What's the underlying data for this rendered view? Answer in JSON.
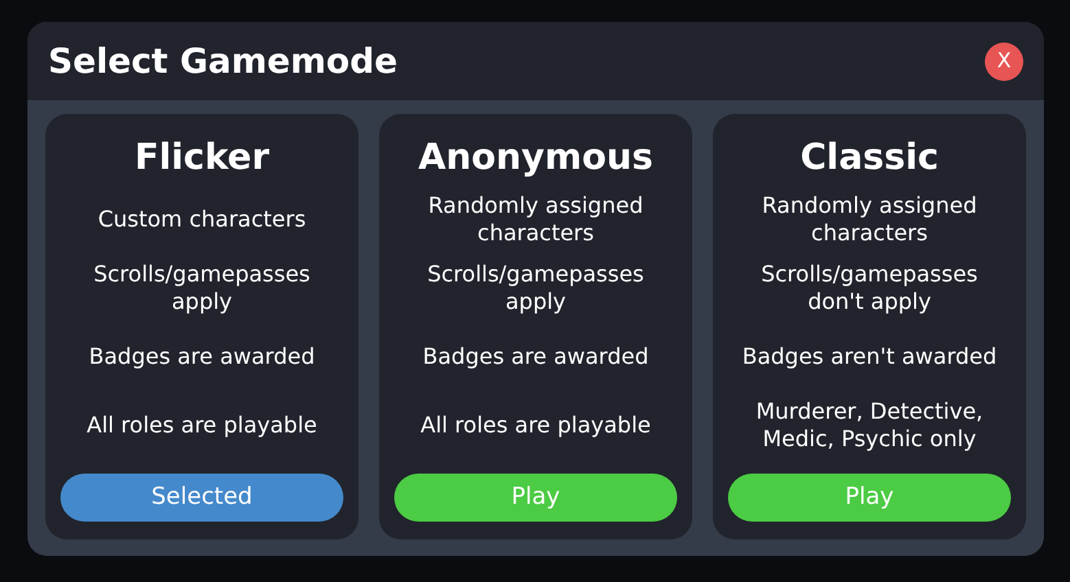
{
  "window": {
    "title": "Select Gamemode",
    "close": "X"
  },
  "modes": [
    {
      "name": "Flicker",
      "features": [
        "Custom characters",
        "Scrolls/gamepasses apply",
        "Badges are awarded",
        "All roles are playable"
      ],
      "button": "Selected",
      "selected": true
    },
    {
      "name": "Anonymous",
      "features": [
        "Randomly assigned characters",
        "Scrolls/gamepasses apply",
        "Badges are awarded",
        "All roles are playable"
      ],
      "button": "Play",
      "selected": false
    },
    {
      "name": "Classic",
      "features": [
        "Randomly assigned characters",
        "Scrolls/gamepasses don't apply",
        "Badges aren't awarded",
        "Murderer, Detective, Medic, Psychic only"
      ],
      "button": "Play",
      "selected": false
    }
  ]
}
